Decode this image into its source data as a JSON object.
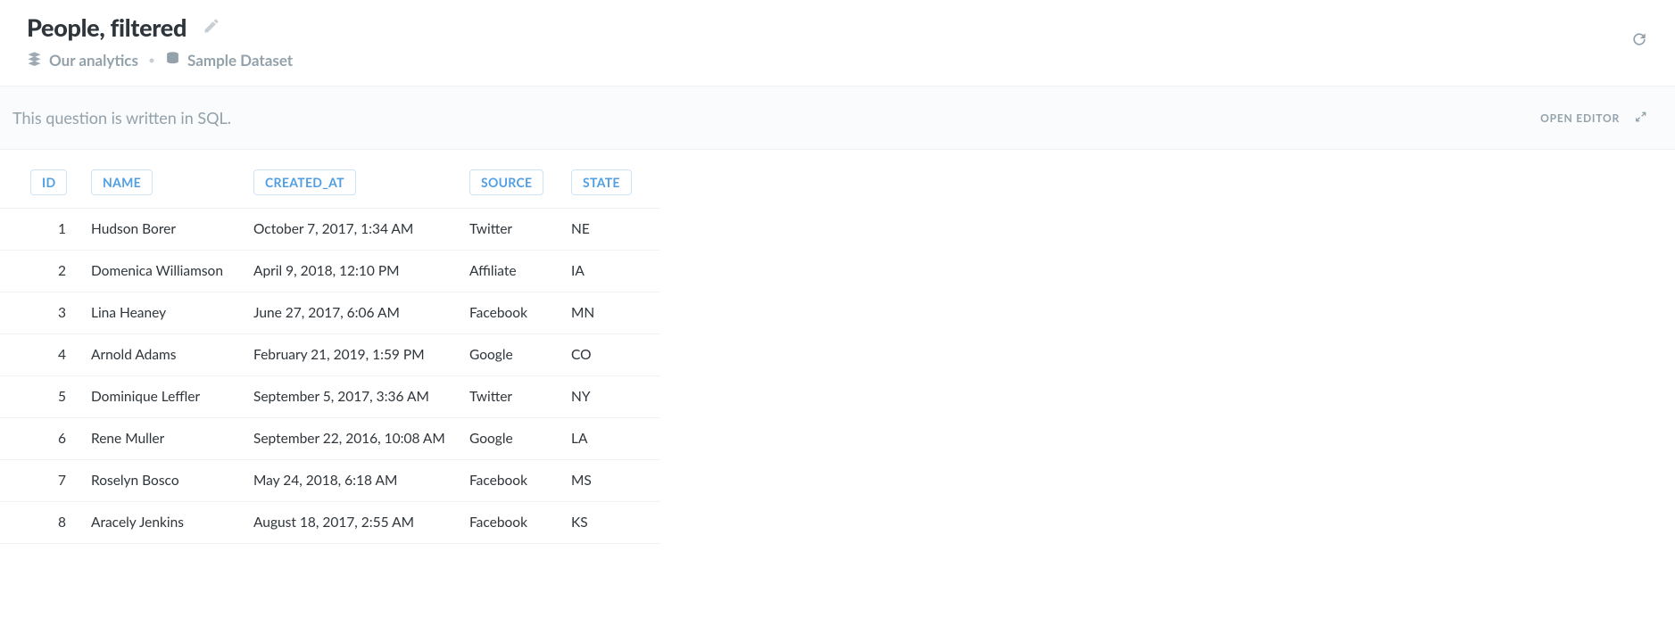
{
  "header": {
    "title": "People, filtered",
    "collection": "Our analytics",
    "dataset": "Sample Dataset"
  },
  "sql_bar": {
    "message": "This question is written in SQL.",
    "open_editor_label": "OPEN EDITOR"
  },
  "table": {
    "columns": [
      "ID",
      "NAME",
      "CREATED_AT",
      "SOURCE",
      "STATE"
    ],
    "rows": [
      {
        "id": "1",
        "name": "Hudson Borer",
        "created_at": "October 7, 2017, 1:34 AM",
        "source": "Twitter",
        "state": "NE"
      },
      {
        "id": "2",
        "name": "Domenica Williamson",
        "created_at": "April 9, 2018, 12:10 PM",
        "source": "Affiliate",
        "state": "IA"
      },
      {
        "id": "3",
        "name": "Lina Heaney",
        "created_at": "June 27, 2017, 6:06 AM",
        "source": "Facebook",
        "state": "MN"
      },
      {
        "id": "4",
        "name": "Arnold Adams",
        "created_at": "February 21, 2019, 1:59 PM",
        "source": "Google",
        "state": "CO"
      },
      {
        "id": "5",
        "name": "Dominique Leffler",
        "created_at": "September 5, 2017, 3:36 AM",
        "source": "Twitter",
        "state": "NY"
      },
      {
        "id": "6",
        "name": "Rene Muller",
        "created_at": "September 22, 2016, 10:08 AM",
        "source": "Google",
        "state": "LA"
      },
      {
        "id": "7",
        "name": "Roselyn Bosco",
        "created_at": "May 24, 2018, 6:18 AM",
        "source": "Facebook",
        "state": "MS"
      },
      {
        "id": "8",
        "name": "Aracely Jenkins",
        "created_at": "August 18, 2017, 2:55 AM",
        "source": "Facebook",
        "state": "KS"
      }
    ]
  }
}
